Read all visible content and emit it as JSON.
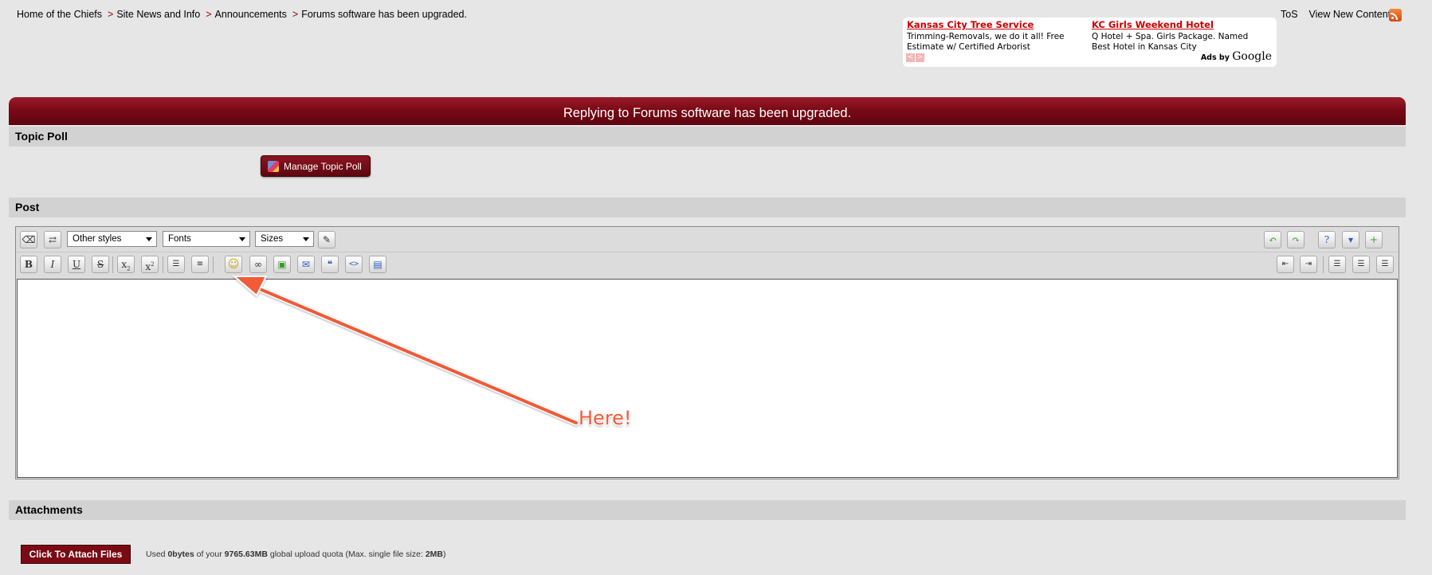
{
  "breadcrumb": {
    "items": [
      "Home of the Chiefs",
      "Site News and Info",
      "Announcements",
      "Forums software has been upgraded."
    ],
    "separator": ">"
  },
  "toplinks": {
    "tos": "ToS",
    "new_content": "View New Content",
    "rss_icon": "rss-icon"
  },
  "ads": {
    "ad1": {
      "title": "Kansas City Tree Service",
      "text": "Trimming-Removals, we do it all! Free Estimate w/ Certified Arborist"
    },
    "ad2": {
      "title": "KC Girls Weekend Hotel",
      "text": "Q Hotel + Spa. Girls Package. Named Best Hotel in Kansas City"
    },
    "prev": "<",
    "next": ">",
    "ads_by": "Ads by",
    "google": "Google"
  },
  "header": {
    "title": "Replying to Forums software has been upgraded."
  },
  "topic_poll": {
    "heading": "Topic Poll",
    "button": "Manage Topic Poll"
  },
  "post": {
    "heading": "Post",
    "styles_select": "Other styles",
    "fonts_select": "Fonts",
    "sizes_select": "Sizes"
  },
  "attachments": {
    "heading": "Attachments",
    "button": "Click To Attach Files",
    "quota_prefix": "Used ",
    "used": "0bytes",
    "quota_mid": " of your ",
    "total": "9765.63MB",
    "quota_mid2": " global upload quota (Max. single file size: ",
    "max": "2MB",
    "quota_end": ")"
  },
  "annotation": {
    "text": "Here!",
    "color": "#f25a38"
  },
  "colors": {
    "maroon": "#7a0a16",
    "background": "#e6e6e6",
    "section": "#d2d2d2"
  }
}
